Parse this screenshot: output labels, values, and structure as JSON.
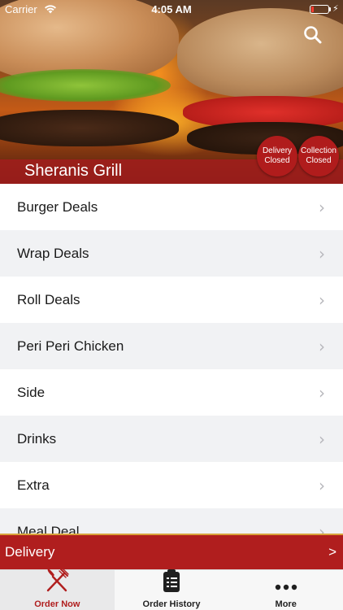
{
  "status_bar": {
    "carrier": "Carrier",
    "time": "4:05 AM",
    "battery_level": 0.15,
    "charging_symbol": "⚡"
  },
  "header": {
    "store_name": "Sheranis Grill",
    "search_icon": "search-icon",
    "badges": {
      "delivery": {
        "line1": "Delivery",
        "line2": "Closed"
      },
      "collection": {
        "line1": "Collection",
        "line2": "Closed"
      }
    }
  },
  "menu": {
    "categories": [
      "Burger Deals",
      "Wrap Deals",
      "Roll Deals",
      "Peri Peri Chicken",
      "Side",
      "Drinks",
      "Extra",
      "Meal Deal"
    ],
    "chevron": "›"
  },
  "delivery_bar": {
    "label": "Delivery",
    "arrow": ">"
  },
  "tabs": [
    {
      "label": "Order Now",
      "icon": "fork-knife-icon",
      "active": true
    },
    {
      "label": "Order History",
      "icon": "clipboard-list-icon",
      "active": false
    },
    {
      "label": "More",
      "icon": "more-dots-icon",
      "active": false
    }
  ],
  "colors": {
    "brand_red": "#b01e1e",
    "accent_gold": "#d9a23a",
    "active_tab_label": "#b01e1e"
  }
}
